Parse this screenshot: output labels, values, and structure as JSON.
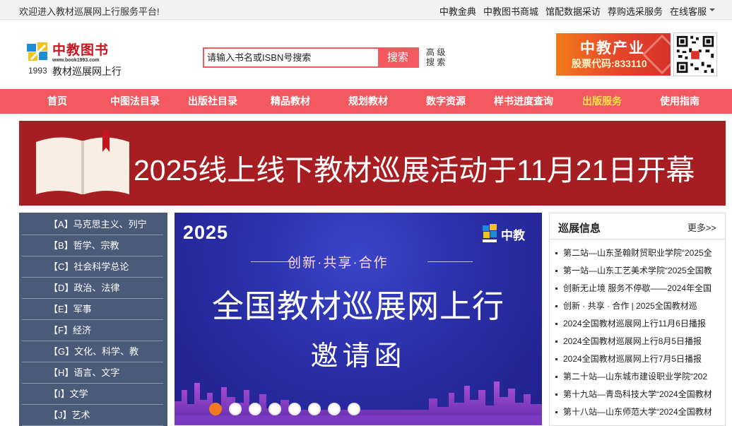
{
  "topbar": {
    "welcome": "欢迎进入教材巡展网上行服务平台!",
    "links": [
      "中教金典",
      "中教图书商城",
      "馆配数据采访",
      "荐购选采服务",
      "在线客服"
    ]
  },
  "logo": {
    "brand": "中教图书",
    "url": "www.book1993.com",
    "year": "1993",
    "slogan": "教材巡展网上行"
  },
  "search": {
    "placeholder": "请输入书名或ISBN号搜索",
    "button": "搜索",
    "advanced_line1": "高 级",
    "advanced_line2": "搜 索"
  },
  "promo": {
    "line1": "中教产业",
    "line2": "股票代码:833110"
  },
  "nav": {
    "items": [
      {
        "label": "首页"
      },
      {
        "label": "中图法目录"
      },
      {
        "label": "出版社目录"
      },
      {
        "label": "精品教材"
      },
      {
        "label": "规划教材"
      },
      {
        "label": "数字资源"
      },
      {
        "label": "样书进度查询"
      },
      {
        "label": "出版服务"
      },
      {
        "label": "使用指南"
      }
    ],
    "highlight_color": "#ffe14d"
  },
  "banner": {
    "title": "2025线上线下教材巡展活动于11月21日开幕"
  },
  "categories": [
    "【A】马克思主义、列宁",
    "【B】哲学、宗教",
    "【C】社会科学总论",
    "【D】政治、法律",
    "【E】军事",
    "【F】经济",
    "【G】文化、科学、教",
    "【H】语言、文字",
    "【I】文学",
    "【J】艺术"
  ],
  "slider": {
    "year": "2025",
    "logo_text": "中教",
    "slogan": "创新·共享·合作",
    "title": "全国教材巡展网上行",
    "subtitle": "邀请函",
    "slide_count": 8,
    "active_index": 0
  },
  "news": {
    "title": "巡展信息",
    "more": "更多>>",
    "items": [
      "第二站—山东圣翰财贸职业学院“2025全",
      "第一站—山东工艺美术学院“2025全国教",
      "创新无止境 服务不停歇——2024年全国",
      "创新 · 共享 · 合作 | 2025全国教材巡",
      "2024全国教材巡展网上行11月6日播报",
      "2024全国教材巡展网上行8月5日播报",
      "2024全国教材巡展网上行7月5日播报",
      "第二十站—山东城市建设职业学院“202",
      "第十九站—青岛科技大学“2024全国教材",
      "第十八站—山东师范大学“2024全国教材"
    ]
  },
  "colors": {
    "accent": "#f25a60",
    "banner": "#a61e22",
    "category_bg": "#4a5b79",
    "dot_active": "#f07a22"
  }
}
